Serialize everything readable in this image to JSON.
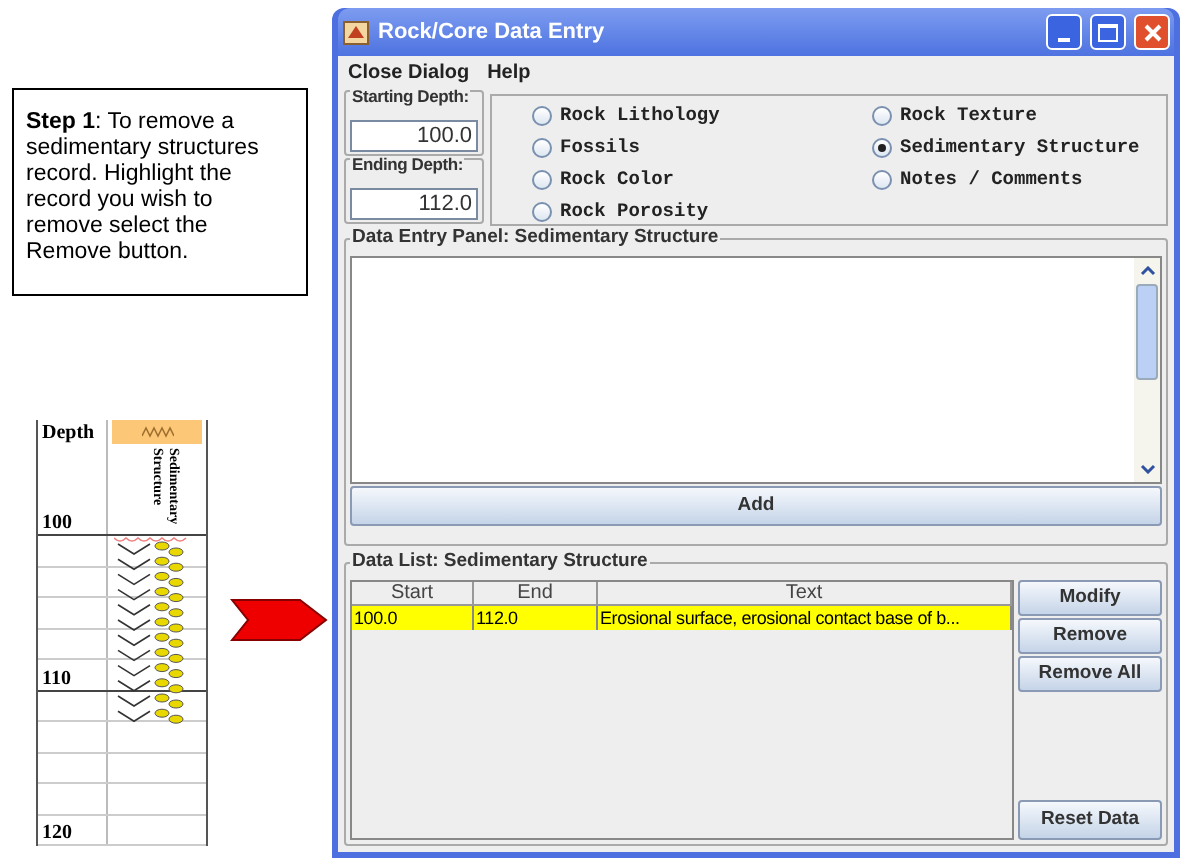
{
  "callout": {
    "text": "**Step 1**: To remove a sedimentary structures record.  Highlight the record you wish to remove select the Remove button."
  },
  "log": {
    "depth_header": "Depth",
    "column_header": "Sedimentary Structure",
    "depth_labels": [
      "100",
      "110",
      "120"
    ]
  },
  "window": {
    "title": "Rock/Core Data Entry"
  },
  "menu": [
    "Close Dialog",
    "Help"
  ],
  "starting_depth": {
    "label": "Starting Depth:",
    "value": "100.0"
  },
  "ending_depth": {
    "label": "Ending Depth:",
    "value": "112.0"
  },
  "categories": [
    {
      "label": "Rock Lithology",
      "selected": false
    },
    {
      "label": "Rock Texture",
      "selected": false
    },
    {
      "label": "Fossils",
      "selected": false
    },
    {
      "label": "Sedimentary Structure",
      "selected": true
    },
    {
      "label": "Rock Color",
      "selected": false
    },
    {
      "label": "Notes / Comments",
      "selected": false
    },
    {
      "label": "Rock Porosity",
      "selected": false
    }
  ],
  "entry_panel": {
    "title": "Data Entry Panel: Sedimentary Structure",
    "add_button": "Add"
  },
  "data_list": {
    "title": "Data List: Sedimentary Structure",
    "columns": [
      "Start",
      "End",
      "Text"
    ],
    "rows": [
      {
        "cells": [
          "100.0",
          "112.0",
          "Erosional surface, erosional contact base of b..."
        ],
        "selected": true
      }
    ],
    "buttons": [
      "Modify",
      "Remove",
      "Remove All"
    ],
    "reset_button": "Reset Data"
  }
}
